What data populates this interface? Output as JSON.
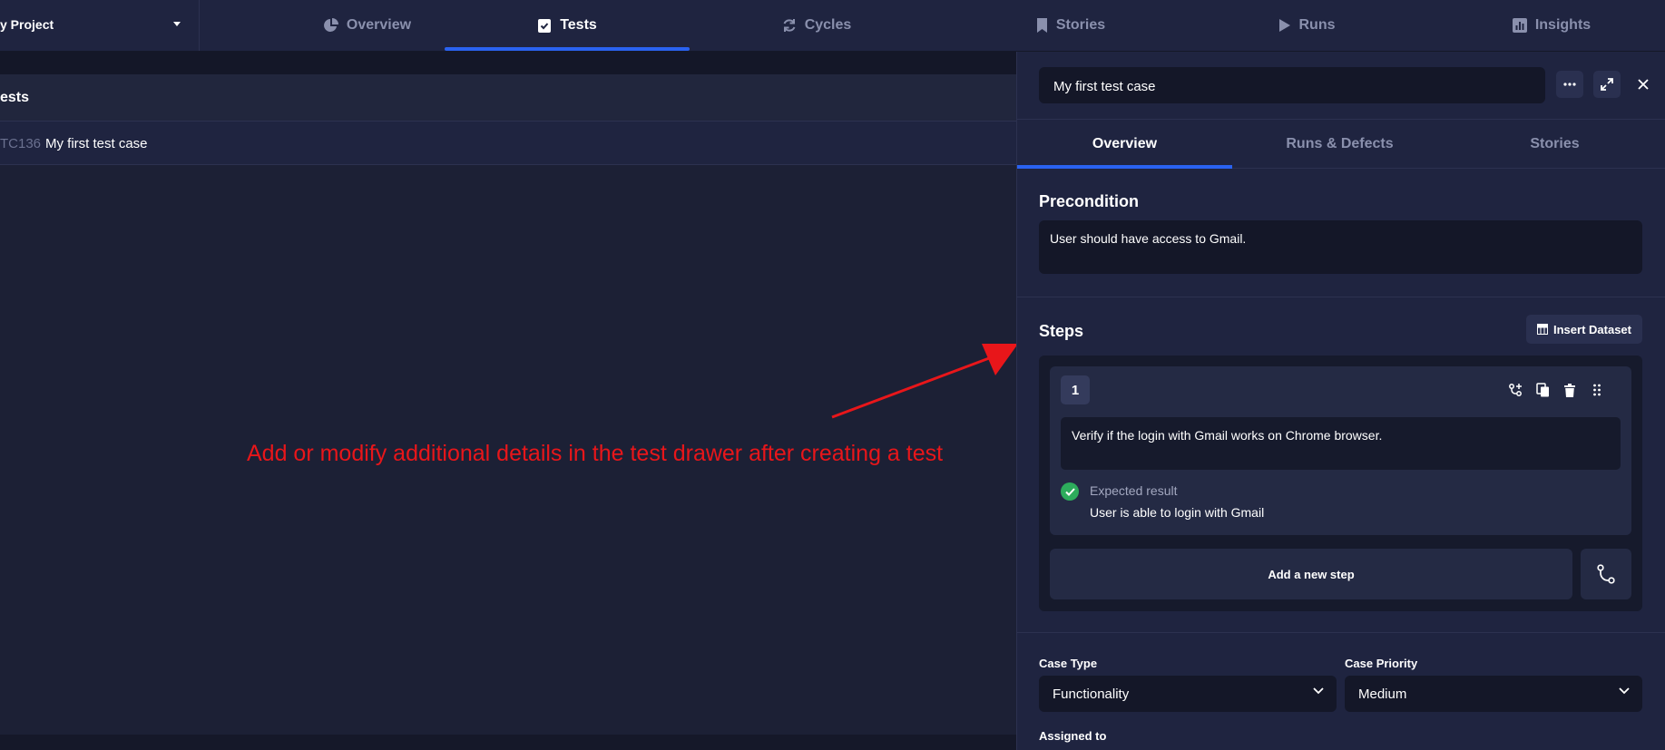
{
  "nav": {
    "project_name": "y Project",
    "tabs": [
      {
        "label": "Overview",
        "icon": "pie-chart-icon"
      },
      {
        "label": "Tests",
        "icon": "clipboard-check-icon",
        "active": true
      },
      {
        "label": "Cycles",
        "icon": "refresh-icon"
      },
      {
        "label": "Stories",
        "icon": "bookmark-icon"
      },
      {
        "label": "Runs",
        "icon": "play-icon"
      },
      {
        "label": "Insights",
        "icon": "bar-chart-icon"
      }
    ]
  },
  "list": {
    "header": "ests",
    "rows": [
      {
        "id": "TC136",
        "title": "My first test case"
      }
    ]
  },
  "annotation": "Add or modify additional details in the test drawer after creating a test",
  "drawer": {
    "title": "My first test case",
    "tabs": [
      "Overview",
      "Runs & Defects",
      "Stories"
    ],
    "precondition": {
      "heading": "Precondition",
      "text": "User should have access to Gmail."
    },
    "steps": {
      "heading": "Steps",
      "insert_dataset": "Insert Dataset",
      "items": [
        {
          "number": "1",
          "text": "Verify if the login with Gmail works on Chrome browser.",
          "expected_label": "Expected result",
          "expected_value": "User is able to login with Gmail"
        }
      ],
      "add_step": "Add a new step"
    },
    "fields": {
      "case_type_label": "Case Type",
      "case_type_value": "Functionality",
      "case_priority_label": "Case Priority",
      "case_priority_value": "Medium",
      "assigned_to_label": "Assigned to"
    }
  },
  "colors": {
    "accent": "#2a62f0",
    "annotation": "#e8161a",
    "success": "#2dac5c"
  }
}
